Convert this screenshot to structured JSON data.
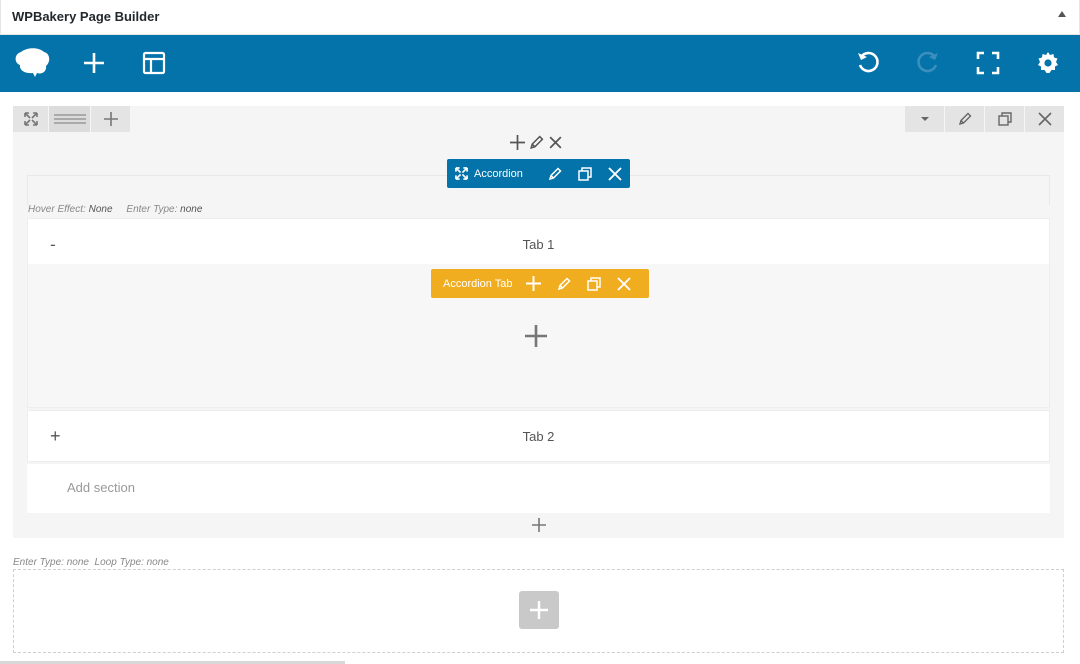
{
  "panel": {
    "title": "WPBakery Page Builder"
  },
  "toolbar": {
    "background": "#0473aa",
    "icons": [
      "logo-icon",
      "add-element-icon",
      "templates-icon",
      "undo-icon",
      "redo-icon",
      "fullscreen-icon",
      "settings-icon"
    ]
  },
  "accordion": {
    "label": "Accordion",
    "meta_hover_label": "Hover Effect",
    "meta_hover_value": "None",
    "meta_enter_label": "Enter Type",
    "meta_enter_value": "none"
  },
  "tabs": [
    {
      "title": "Tab 1",
      "toggle": "-"
    },
    {
      "title": "Tab 2",
      "toggle": "+"
    }
  ],
  "accordion_tab": {
    "label": "Accordion Tab",
    "color": "#f0ad1f"
  },
  "add_section": {
    "label": "Add section"
  },
  "second_row": {
    "meta_enter_label": "Enter Type",
    "meta_enter_value": "none",
    "meta_loop_label": "Loop Type",
    "meta_loop_value": "none"
  }
}
